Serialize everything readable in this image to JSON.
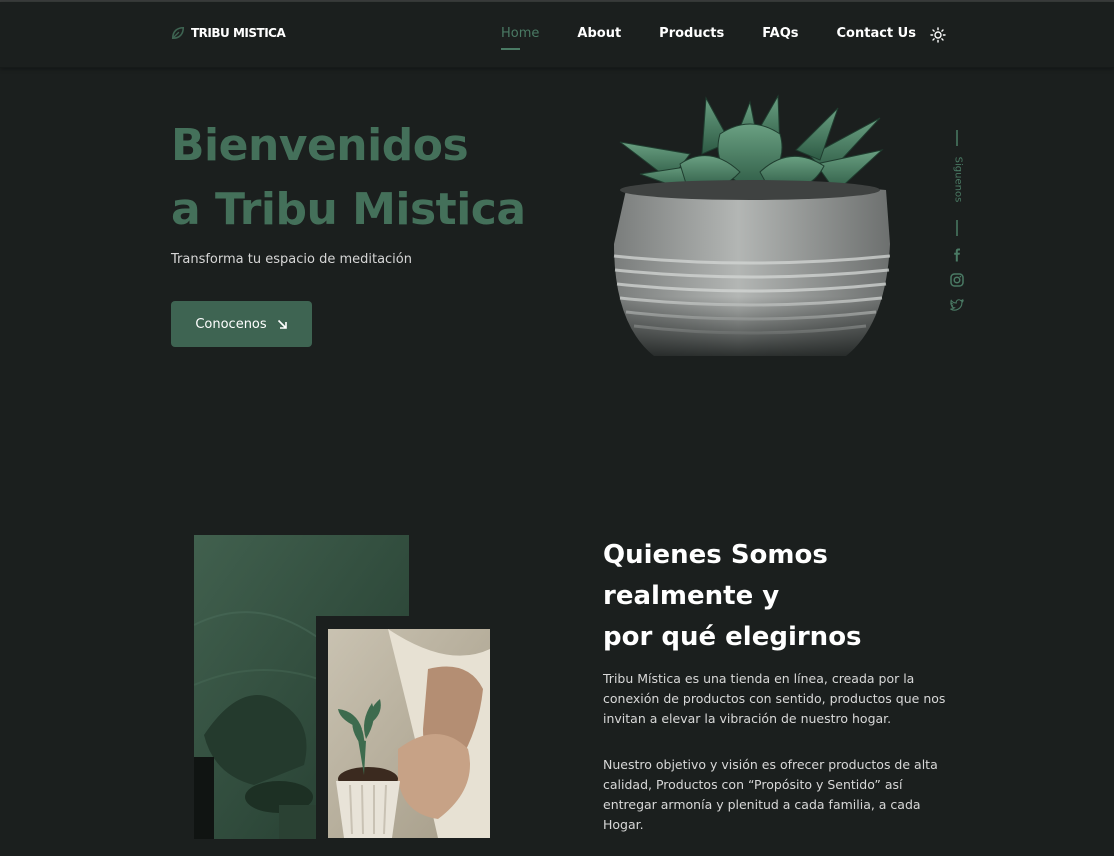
{
  "header": {
    "logo_text": "TRIBU MISTICA",
    "nav": [
      {
        "label": "Home",
        "active": true
      },
      {
        "label": "About",
        "active": false
      },
      {
        "label": "Products",
        "active": false
      },
      {
        "label": "FAQs",
        "active": false
      },
      {
        "label": "Contact Us",
        "active": false
      }
    ],
    "theme_icon": "sun-icon"
  },
  "hero": {
    "title_line1": "Bienvenidos",
    "title_line2": "a Tribu Mistica",
    "subtitle": "Transforma tu espacio de meditación",
    "cta_label": "Conocenos",
    "cta_icon": "arrow-down-right-icon"
  },
  "social": {
    "label": "Siguenos",
    "icons": [
      "facebook-icon",
      "instagram-icon",
      "twitter-icon"
    ]
  },
  "about": {
    "title_line1": "Quienes Somos",
    "title_line2": "realmente y",
    "title_line3": "por qué elegirnos",
    "paragraph1": "Tribu Mística es una tienda en línea, creada por la conexión de productos con sentido, productos que nos invitan a elevar la vibración de nuestro hogar.",
    "paragraph2": "Nuestro objetivo y visión es ofrecer productos de alta calidad, Productos con “Propósito y Sentido” así entregar armonía y plenitud a cada familia, a cada Hogar."
  },
  "colors": {
    "background": "#1b1f1e",
    "accent": "#3e6452",
    "accent_text": "#44705a",
    "text": "#ffffff"
  }
}
